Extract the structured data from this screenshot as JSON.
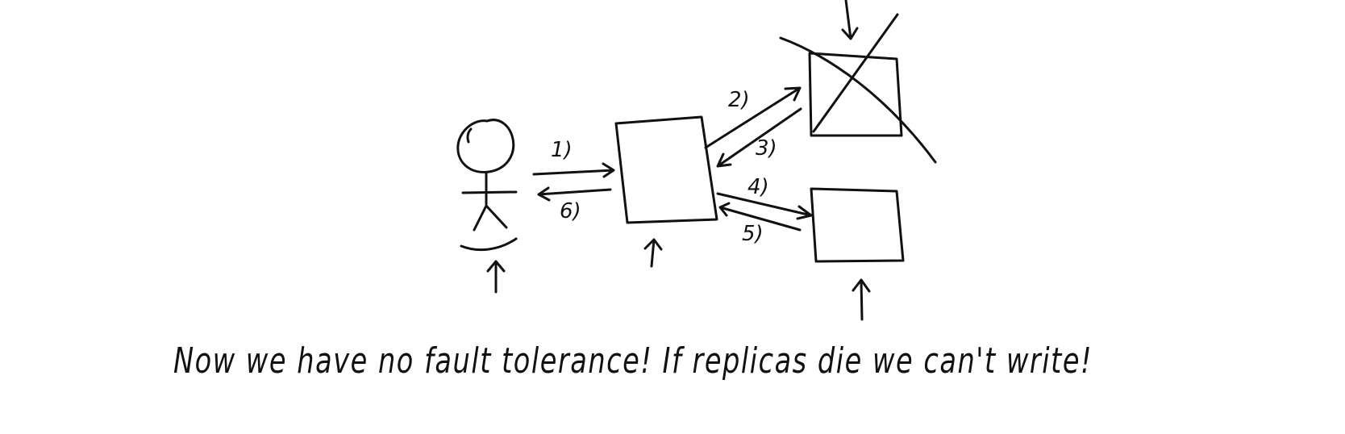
{
  "diagram": {
    "arrow_labels": [
      "1)",
      "2)",
      "3)",
      "4)",
      "5)",
      "6)"
    ],
    "caption": "Now we have no fault tolerance! If replicas die we can't write!",
    "ink_color": "#111111",
    "background_color": "#ffffff"
  }
}
